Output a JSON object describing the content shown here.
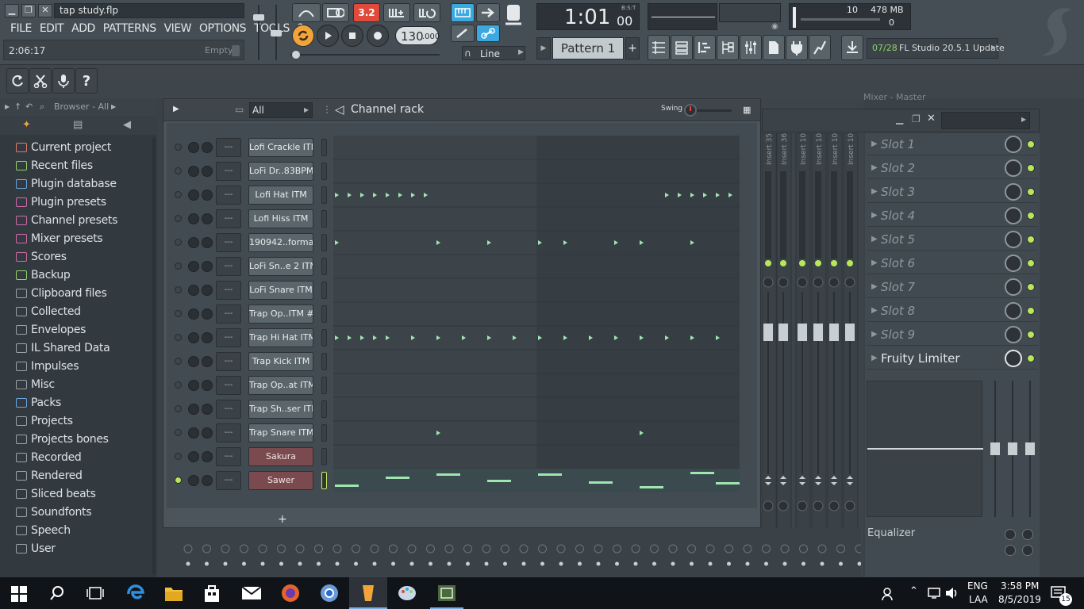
{
  "app": {
    "filename": "tap study.flp",
    "menu": [
      "FILE",
      "EDIT",
      "ADD",
      "PATTERNS",
      "VIEW",
      "OPTIONS",
      "TOOLS",
      "?"
    ],
    "hint_time": "2:06:17",
    "hint_empty": "Empty"
  },
  "transport": {
    "tempo_value": "130",
    "tempo_decimal": ".000",
    "song_position_main": "1:01",
    "song_position_small": "00",
    "song_position_label": "B:S:T",
    "snap_mode": "Line",
    "pattern_label": "Pattern 1",
    "typing_keyboard_label": "3.2",
    "memory_count": "10",
    "memory_value": "478 MB",
    "cpu_value": "0",
    "news_date": "07/28",
    "news_text": "FL Studio 20.5.1 Update"
  },
  "browser": {
    "title": "Browser - All",
    "items": [
      {
        "label": "Current project",
        "icon": "project-icon",
        "color": "#e07a6a"
      },
      {
        "label": "Recent files",
        "icon": "recent-icon",
        "color": "#8fd36a"
      },
      {
        "label": "Plugin database",
        "icon": "plugin-db-icon",
        "color": "#6aa8e0"
      },
      {
        "label": "Plugin presets",
        "icon": "plugin-preset-icon",
        "color": "#d06aa8"
      },
      {
        "label": "Channel presets",
        "icon": "channel-preset-icon",
        "color": "#d06aa8"
      },
      {
        "label": "Mixer presets",
        "icon": "mixer-preset-icon",
        "color": "#d06aa8"
      },
      {
        "label": "Scores",
        "icon": "note-icon",
        "color": "#d06aa8"
      },
      {
        "label": "Backup",
        "icon": "backup-icon",
        "color": "#8fd36a"
      },
      {
        "label": "Clipboard files",
        "icon": "folder-icon",
        "color": "#9aa3a8"
      },
      {
        "label": "Collected",
        "icon": "folder-icon",
        "color": "#9aa3a8"
      },
      {
        "label": "Envelopes",
        "icon": "folder-icon",
        "color": "#9aa3a8"
      },
      {
        "label": "IL Shared Data",
        "icon": "folder-icon",
        "color": "#9aa3a8"
      },
      {
        "label": "Impulses",
        "icon": "folder-icon",
        "color": "#9aa3a8"
      },
      {
        "label": "Misc",
        "icon": "folder-icon",
        "color": "#9aa3a8"
      },
      {
        "label": "Packs",
        "icon": "packs-icon",
        "color": "#6aa8e0"
      },
      {
        "label": "Projects",
        "icon": "folder-icon",
        "color": "#9aa3a8"
      },
      {
        "label": "Projects bones",
        "icon": "folder-icon",
        "color": "#9aa3a8"
      },
      {
        "label": "Recorded",
        "icon": "recorded-icon",
        "color": "#9aa3a8"
      },
      {
        "label": "Rendered",
        "icon": "rendered-icon",
        "color": "#9aa3a8"
      },
      {
        "label": "Sliced beats",
        "icon": "sliced-icon",
        "color": "#9aa3a8"
      },
      {
        "label": "Soundfonts",
        "icon": "soundfont-icon",
        "color": "#9aa3a8"
      },
      {
        "label": "Speech",
        "icon": "speech-icon",
        "color": "#9aa3a8"
      },
      {
        "label": "User",
        "icon": "user-icon",
        "color": "#9aa3a8"
      }
    ]
  },
  "channel_rack": {
    "title": "Channel rack",
    "filter": "All",
    "swing_label": "Swing",
    "add_label": "+",
    "channels": [
      {
        "name": "Lofi Crackle ITM",
        "num": "---",
        "style": "normal",
        "steps": []
      },
      {
        "name": "LoFi Dr..83BPM",
        "num": "---",
        "style": "normal",
        "steps": []
      },
      {
        "name": "Lofi Hat ITM",
        "num": "---",
        "style": "normal",
        "steps": [
          0,
          1,
          2,
          3,
          4,
          5,
          6,
          7,
          26,
          27,
          28,
          29,
          30,
          31
        ]
      },
      {
        "name": "Lofi Hiss ITM",
        "num": "---",
        "style": "normal",
        "steps": []
      },
      {
        "name": "190942..format",
        "num": "---",
        "style": "normal",
        "steps": [
          0,
          8,
          12,
          16,
          18,
          22,
          24,
          28
        ]
      },
      {
        "name": "LoFi Sn..e 2 ITM",
        "num": "---",
        "style": "normal",
        "steps": []
      },
      {
        "name": "LoFi Snare ITM",
        "num": "---",
        "style": "normal",
        "steps": []
      },
      {
        "name": "Trap Op..ITM #2",
        "num": "---",
        "style": "normal",
        "steps": []
      },
      {
        "name": "Trap Hi Hat ITM",
        "num": "---",
        "style": "normal",
        "steps": [
          0,
          1,
          2,
          3,
          4,
          6,
          8,
          10,
          12,
          14,
          16,
          18,
          20,
          22,
          24,
          26,
          28,
          30
        ]
      },
      {
        "name": "Trap Kick ITM",
        "num": "---",
        "style": "normal",
        "steps": []
      },
      {
        "name": "Trap Op..at ITM",
        "num": "---",
        "style": "normal",
        "steps": []
      },
      {
        "name": "Trap Sh..ser ITM",
        "num": "---",
        "style": "normal",
        "steps": []
      },
      {
        "name": "Trap Snare ITM",
        "num": "---",
        "style": "normal",
        "steps": [
          8,
          24
        ]
      },
      {
        "name": "Sakura",
        "num": "---",
        "style": "red",
        "steps": []
      },
      {
        "name": "Sawer",
        "num": "---",
        "style": "red",
        "steps": [],
        "selected": true
      }
    ]
  },
  "mixer": {
    "title": "Mixer - Master",
    "inserts": [
      "Insert 35",
      "Insert 36",
      "Insert 10",
      "Insert 10",
      "Insert 10",
      "Insert 10"
    ],
    "slots": [
      "Slot 1",
      "Slot 2",
      "Slot 3",
      "Slot 4",
      "Slot 5",
      "Slot 6",
      "Slot 7",
      "Slot 8",
      "Slot 9"
    ],
    "limiter": "Fruity Limiter",
    "equalizer": "Equalizer"
  },
  "taskbar": {
    "lang": "ENG",
    "lang2": "LAA",
    "time": "3:58 PM",
    "date": "8/5/2019",
    "notifications": "15"
  }
}
